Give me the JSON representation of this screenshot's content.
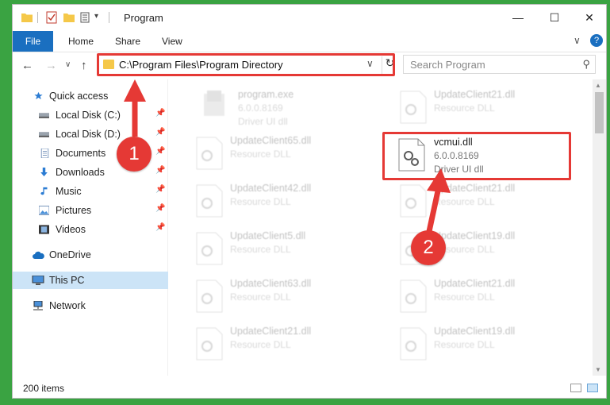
{
  "window": {
    "title": "Program",
    "minimize_glyph": "—",
    "maximize_glyph": "☐",
    "close_glyph": "✕",
    "quick_access_dropdown": "▾"
  },
  "ribbon": {
    "tabs": [
      "File",
      "Home",
      "Share",
      "View"
    ],
    "collapse_glyph": "∨",
    "help_glyph": "?"
  },
  "nav": {
    "back_glyph": "←",
    "forward_glyph": "→",
    "recent_glyph": "∨",
    "up_glyph": "↑",
    "address": "C:\\Program Files\\Program Directory",
    "address_chevron": "∨",
    "refresh_glyph": "↻",
    "search_placeholder": "Search Program",
    "search_glyph": "⚲"
  },
  "sidebar": {
    "items": [
      {
        "label": "Quick access",
        "icon": "star-icon",
        "pinned": false
      },
      {
        "label": "Local Disk (C:)",
        "icon": "drive-icon",
        "pinned": true
      },
      {
        "label": "Local Disk (D:)",
        "icon": "drive-icon",
        "pinned": true
      },
      {
        "label": "Documents",
        "icon": "documents-icon",
        "pinned": true
      },
      {
        "label": "Downloads",
        "icon": "downloads-icon",
        "pinned": true
      },
      {
        "label": "Music",
        "icon": "music-icon",
        "pinned": true
      },
      {
        "label": "Pictures",
        "icon": "pictures-icon",
        "pinned": true
      },
      {
        "label": "Videos",
        "icon": "videos-icon",
        "pinned": true
      },
      {
        "label": "OneDrive",
        "icon": "cloud-icon",
        "pinned": false
      },
      {
        "label": "This PC",
        "icon": "computer-icon",
        "pinned": false,
        "selected": true
      },
      {
        "label": "Network",
        "icon": "network-icon",
        "pinned": false
      }
    ],
    "pin_glyph": "📌"
  },
  "files": [
    {
      "name": "program.exe",
      "line1": "6.0.0.8169",
      "line2": "Driver UI dll",
      "faded": true
    },
    {
      "name": "UpdateClient21.dll",
      "line1": "Resource DLL",
      "line2": "",
      "faded": true
    },
    {
      "name": "UpdateClient65.dll",
      "line1": "Resource DLL",
      "line2": "",
      "faded": true
    },
    {
      "name": "vcmui.dll",
      "line1": "6.0.0.8169",
      "line2": "Driver UI dll",
      "faded": false
    },
    {
      "name": "UpdateClient42.dll",
      "line1": "Resource DLL",
      "line2": "",
      "faded": true
    },
    {
      "name": "UpdateClient21.dll",
      "line1": "Resource DLL",
      "line2": "",
      "faded": true
    },
    {
      "name": "UpdateClient5.dll",
      "line1": "Resource DLL",
      "line2": "",
      "faded": true
    },
    {
      "name": "UpdateClient19.dll",
      "line1": "Resource DLL",
      "line2": "",
      "faded": true
    },
    {
      "name": "UpdateClient63.dll",
      "line1": "Resource DLL",
      "line2": "",
      "faded": true
    },
    {
      "name": "UpdateClient21.dll",
      "line1": "Resource DLL",
      "line2": "",
      "faded": true
    },
    {
      "name": "UpdateClient21.dll",
      "line1": "Resource DLL",
      "line2": "",
      "faded": true
    },
    {
      "name": "UpdateClient19.dll",
      "line1": "Resource DLL",
      "line2": "",
      "faded": true
    }
  ],
  "status": {
    "item_count": "200 items"
  },
  "annotations": {
    "step1": "1",
    "step2": "2",
    "color": "#e53935"
  },
  "colors": {
    "background": "#3aa342",
    "file_tab": "#1a6fc0",
    "selected_nav": "#cce4f7"
  }
}
